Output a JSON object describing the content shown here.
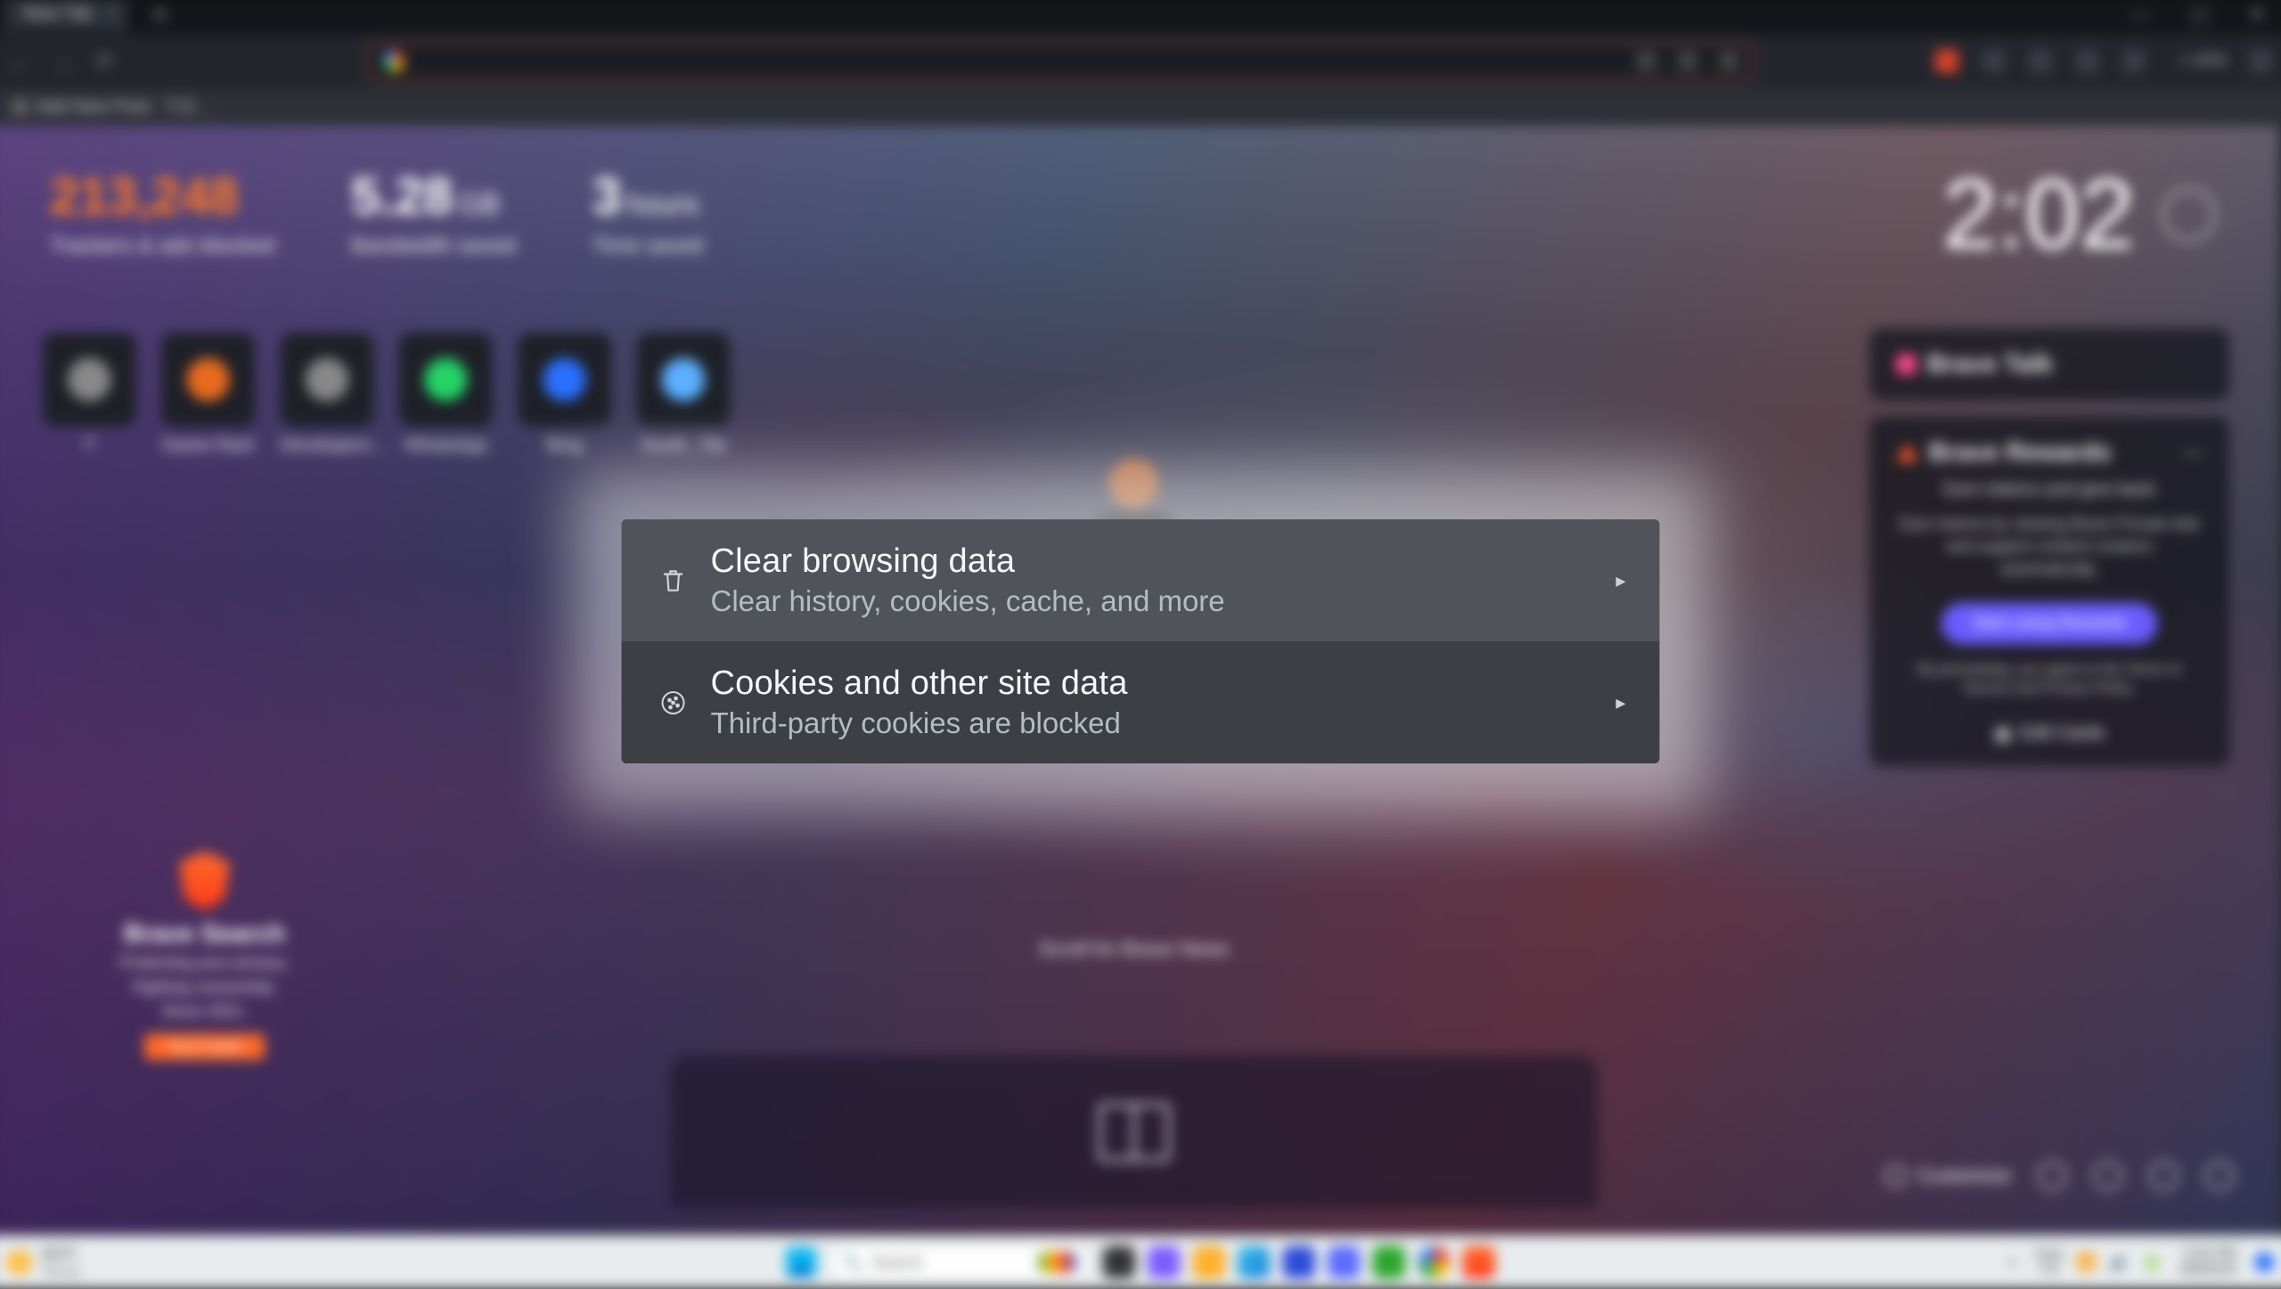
{
  "window": {
    "tab_title": "New Tab",
    "min": "—",
    "max": "▢",
    "close": "✕"
  },
  "bookmarks": {
    "item1": "Add New Post · T-D…"
  },
  "toolbar": {
    "vpn_label": "+ VPN"
  },
  "stats": {
    "trackers_value": "213,248",
    "trackers_label": "Trackers & ads blocked",
    "bandwidth_value": "5.28",
    "bandwidth_unit": "GB",
    "bandwidth_label": "Bandwidth saved",
    "time_value": "3",
    "time_unit": "hours",
    "time_label": "Time saved"
  },
  "clock": {
    "time": "2:02"
  },
  "shortcuts": [
    {
      "label": "T"
    },
    {
      "label": "Game Rant"
    },
    {
      "label": "Developers…"
    },
    {
      "label": "WhatsApp"
    },
    {
      "label": "Bing"
    },
    {
      "label": "South_Tile"
    }
  ],
  "cards": {
    "talk_title": "Brave Talk",
    "rewards_title": "Brave Rewards",
    "rewards_subtitle": "Earn tokens and give back",
    "rewards_desc": "Earn tokens by viewing Brave Private Ads and support content creators automatically.",
    "rewards_cta": "Start using Rewards",
    "rewards_fine": "By proceeding, you agree to the Terms of Service and Privacy Policy.",
    "edit_cards": "Edit Cards"
  },
  "brave_search": {
    "name": "Brave Search",
    "line1": "Protecting your privacy.",
    "line2": "Fighting censorship.",
    "line3": "Since 2021.",
    "cta": "Try it now!"
  },
  "scroll_prompt": "Scroll for Brave News",
  "customize_label": "Customize",
  "taskbar": {
    "weather_temp": "83°F",
    "weather_desc": "Sunny",
    "search_placeholder": "Search",
    "lang": "ENG",
    "region": "US",
    "time": "2:02 PM",
    "date": "6/8/2023"
  },
  "popup": {
    "row1_title": "Clear browsing data",
    "row1_sub": "Clear history, cookies, cache, and more",
    "row2_title": "Cookies and other site data",
    "row2_sub": "Third-party cookies are blocked"
  }
}
